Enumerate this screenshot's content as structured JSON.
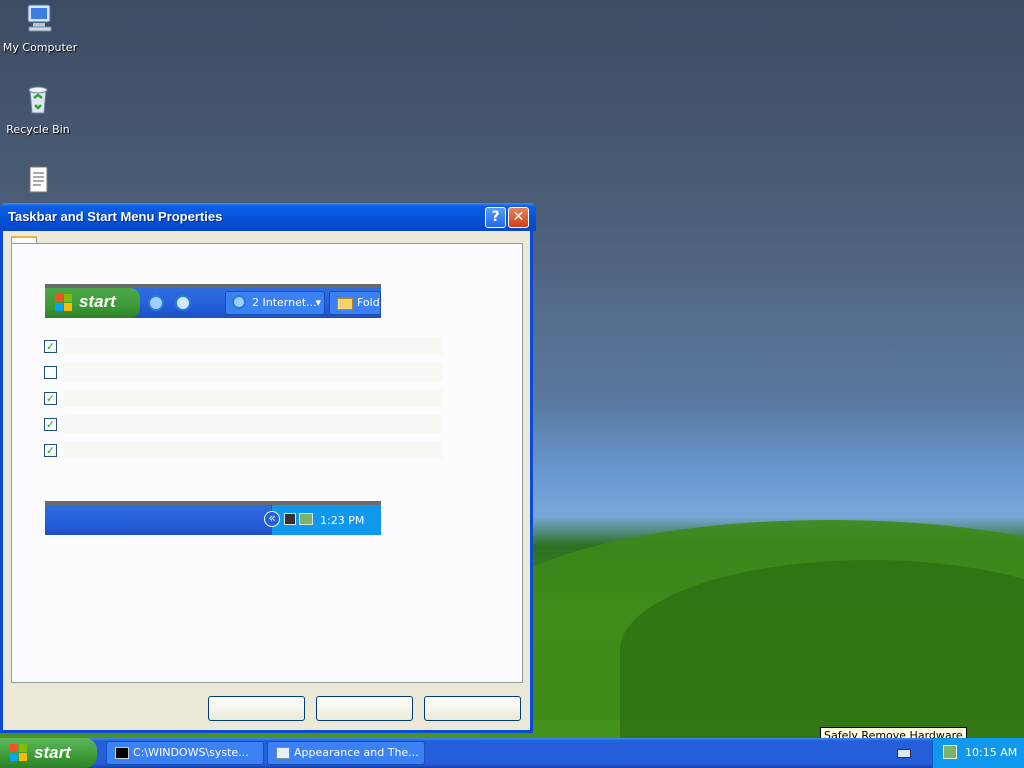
{
  "desktop": {
    "icons": [
      {
        "label": "My Computer",
        "icon": "my-computer-icon"
      },
      {
        "label": "Recycle Bin",
        "icon": "recycle-bin-icon"
      },
      {
        "label": "",
        "icon": "document-icon"
      }
    ]
  },
  "dialog": {
    "title": "Taskbar and Start Menu Properties",
    "help_glyph": "?",
    "close_glyph": "✕",
    "preview_top": {
      "start_label": "start",
      "task1_label": "2 Internet...",
      "task2_label": "Folde"
    },
    "checkboxes": [
      {
        "checked": true
      },
      {
        "checked": false
      },
      {
        "checked": true
      },
      {
        "checked": true
      },
      {
        "checked": true
      }
    ],
    "preview_bottom": {
      "chevron": "«",
      "clock": "1:23 PM"
    },
    "buttons": [
      "",
      "",
      ""
    ]
  },
  "taskbar": {
    "start_label": "start",
    "tasks": [
      {
        "label": "C:\\WINDOWS\\syste...",
        "icon": "console-icon"
      },
      {
        "label": "Appearance and The...",
        "icon": "control-panel-icon"
      }
    ],
    "clock": "10:15 AM",
    "tooltip": "Safely Remove Hardware"
  },
  "colors": {
    "titlebar": "#0650d8",
    "taskbar": "#245edb",
    "start_green": "#3c9b36",
    "tray": "#0f98ee",
    "dialog_bg": "#ece9d8"
  }
}
